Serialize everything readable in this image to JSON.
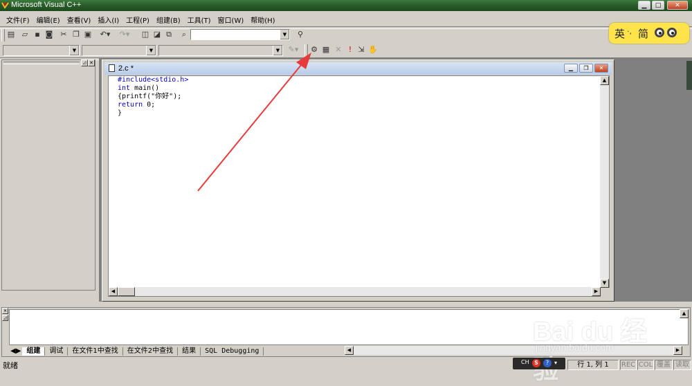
{
  "window": {
    "title": "Microsoft Visual C++"
  },
  "menu": [
    "文件(F)",
    "编辑(E)",
    "查看(V)",
    "插入(I)",
    "工程(P)",
    "组建(B)",
    "工具(T)",
    "窗口(W)",
    "帮助(H)"
  ],
  "ime": {
    "mode": "英",
    "separator": "·,",
    "script": "简"
  },
  "document": {
    "title": "2.c *",
    "code_lines": [
      "#include<stdio.h>",
      "int main()",
      "{printf(\"你好\");",
      "return 0;",
      "}"
    ]
  },
  "output_tabs": [
    "组建",
    "调试",
    "在文件1中查找",
    "在文件2中查找",
    "结果",
    "SQL Debugging"
  ],
  "status": {
    "ready": "就绪",
    "position": "行 1, 列 1",
    "rec": "REC",
    "col": "COL",
    "ovr": "覆盖",
    "read": "读取"
  },
  "tray": {
    "lang": "CH"
  },
  "watermark": {
    "brand": "Bai du 经验",
    "url": "jingyan.baidu.com"
  },
  "colors": {
    "titlebar": "#2a5a2a",
    "keyword": "#0000c0",
    "arrow": "#e83a3a",
    "ime_bg": "#ffe34a"
  }
}
